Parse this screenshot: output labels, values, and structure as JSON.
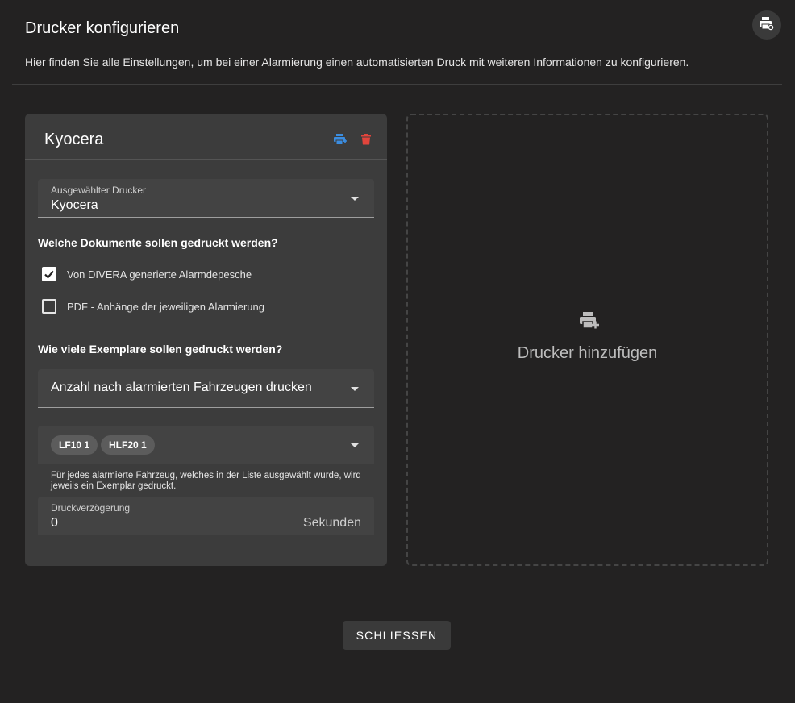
{
  "header": {
    "title": "Drucker konfigurieren",
    "description": "Hier finden Sie alle Einstellungen, um bei einer Alarmierung einen automatisierten Druck mit weiteren Informationen zu konfigurieren.",
    "icon": "printer-settings-icon"
  },
  "printer_card": {
    "title": "Kyocera",
    "test_print_icon": "printer-icon",
    "delete_icon": "trash-icon",
    "accent_color": "#3b8de0",
    "delete_color": "#e2453c",
    "selected_printer": {
      "label": "Ausgewählter Drucker",
      "value": "Kyocera"
    },
    "documents_heading": "Welche Dokumente sollen gedruckt werden?",
    "documents": [
      {
        "label": "Von DIVERA generierte Alarmdepesche",
        "checked": true
      },
      {
        "label": "PDF - Anhänge der jeweiligen Alarmierung",
        "checked": false
      }
    ],
    "copies_heading": "Wie viele Exemplare sollen gedruckt werden?",
    "copies_mode": {
      "value": "Anzahl nach alarmierten Fahrzeugen drucken"
    },
    "vehicles": {
      "chips": [
        "LF10 1",
        "HLF20 1"
      ]
    },
    "vehicles_hint": "Für jedes alarmierte Fahrzeug, welches in der Liste ausgewählt wurde, wird jeweils ein Exemplar gedruckt.",
    "delay": {
      "label": "Druckverzögerung",
      "value": "0",
      "suffix": "Sekunden"
    }
  },
  "add_printer": {
    "label": "Drucker hinzufügen",
    "icon": "printer-add-icon"
  },
  "footer": {
    "close_label": "SCHLIESSEN"
  }
}
